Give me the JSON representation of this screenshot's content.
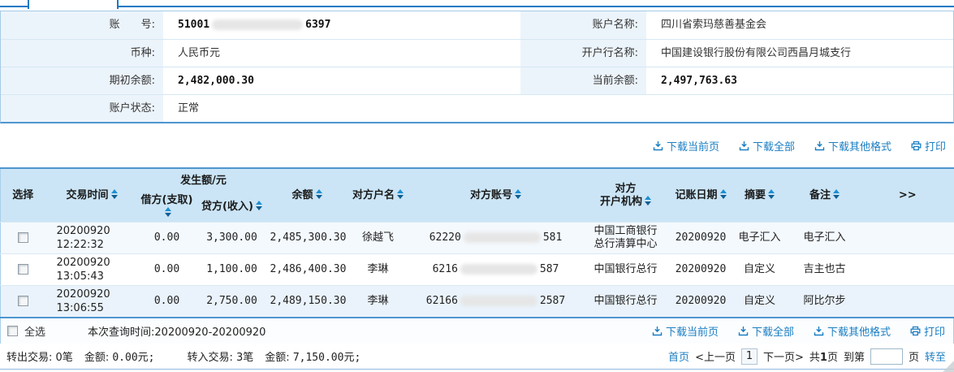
{
  "colors": {
    "accent_blue": "#1779c4",
    "link_blue": "#1b7ec2",
    "table_header_bg": "#cbe5f6",
    "row_alt_bg": "#eaf3fb",
    "label_bg": "#ecf4fb",
    "border_blue": "#4e96cf"
  },
  "account_info": {
    "rows": [
      {
        "label1": "账　　号:",
        "value1_prefix": "51001",
        "value1_suffix": "6397",
        "label2": "账户名称:",
        "value2": "四川省索玛慈善基金会"
      },
      {
        "label1": "币种:",
        "value1": "人民币元",
        "label2": "开户行名称:",
        "value2": "中国建设银行股份有限公司西昌月城支行"
      },
      {
        "label1": "期初余额:",
        "value1": "2,482,000.30",
        "label2": "当前余额:",
        "value2": "2,497,763.63"
      },
      {
        "label1": "账户状态:",
        "value1": "正常"
      }
    ]
  },
  "toolbar": {
    "download_current": "下载当前页",
    "download_all": "下载全部",
    "download_other": "下载其他格式",
    "print": "打印"
  },
  "table": {
    "headers": {
      "select": "选择",
      "time": "交易时间",
      "amount_group": "发生额/元",
      "debit": "借方(支取)",
      "credit": "贷方(收入)",
      "balance": "余额",
      "counterparty_name": "对方户名",
      "counterparty_account": "对方账号",
      "counterparty_bank_l1": "对方",
      "counterparty_bank_l2": "开户机构",
      "posting_date": "记账日期",
      "abstract": "摘要",
      "remark": "备注",
      "more": ">>"
    },
    "rows": [
      {
        "date": "20200920",
        "time": "12:22:32",
        "debit": "0.00",
        "credit": "3,300.00",
        "balance": "2,485,300.30",
        "name": "徐越飞",
        "acct_prefix": "62220",
        "acct_suffix": "581",
        "bank_line1": "中国工商银行",
        "bank_line2": "总行清算中心",
        "post_date": "20200920",
        "abstract": "电子汇入",
        "remark": "电子汇入"
      },
      {
        "date": "20200920",
        "time": "13:05:43",
        "debit": "0.00",
        "credit": "1,100.00",
        "balance": "2,486,400.30",
        "name": "李琳",
        "acct_prefix": "6216",
        "acct_suffix": "587",
        "bank_line1": "中国银行总行",
        "post_date": "20200920",
        "abstract": "自定义",
        "remark": "吉主也古"
      },
      {
        "date": "20200920",
        "time": "13:06:55",
        "debit": "0.00",
        "credit": "2,750.00",
        "balance": "2,489,150.30",
        "name": "李琳",
        "acct_prefix": "62166",
        "acct_suffix": "2587",
        "bank_line1": "中国银行总行",
        "post_date": "20200920",
        "abstract": "自定义",
        "remark": "阿比尔步"
      }
    ]
  },
  "footer": {
    "select_all": "全选",
    "query_time": "本次查询时间:20200920-20200920"
  },
  "summary": {
    "out_label": "转出交易:",
    "out_count": "0笔",
    "out_amount_label": "金额:",
    "out_amount": "0.00元;",
    "in_label": "转入交易:",
    "in_count": "3笔",
    "in_amount_label": "金额:",
    "in_amount": "7,150.00元;"
  },
  "pagination": {
    "first": "首页",
    "prev": "<上一页",
    "page": "1",
    "next": "下一页>",
    "total_prefix": "共",
    "total_pages": "1",
    "total_suffix": "页",
    "goto_label": "到第",
    "page_suffix": "页",
    "go": "转至"
  }
}
